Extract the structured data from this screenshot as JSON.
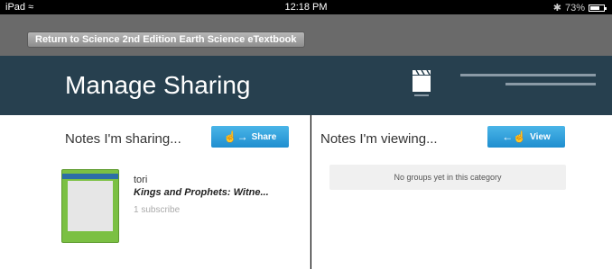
{
  "status": {
    "device": "iPad",
    "time": "12:18 PM",
    "battery": "73%",
    "battery_level": 0.73
  },
  "topbar": {
    "back_label": "Return to Science 2nd Edition Earth Science eTextbook"
  },
  "header": {
    "title": "Manage Sharing"
  },
  "sharing": {
    "title": "Notes I'm sharing...",
    "button_label": "Share",
    "items": [
      {
        "user": "tori",
        "book": "Kings and Prophets: Witne...",
        "subscribers": "1 subscribe"
      }
    ]
  },
  "viewing": {
    "title": "Notes I'm viewing...",
    "button_label": "View",
    "empty_text": "No groups yet in this category"
  },
  "colors": {
    "header_bg": "#27404f",
    "button_blue": "#2a9be0"
  }
}
